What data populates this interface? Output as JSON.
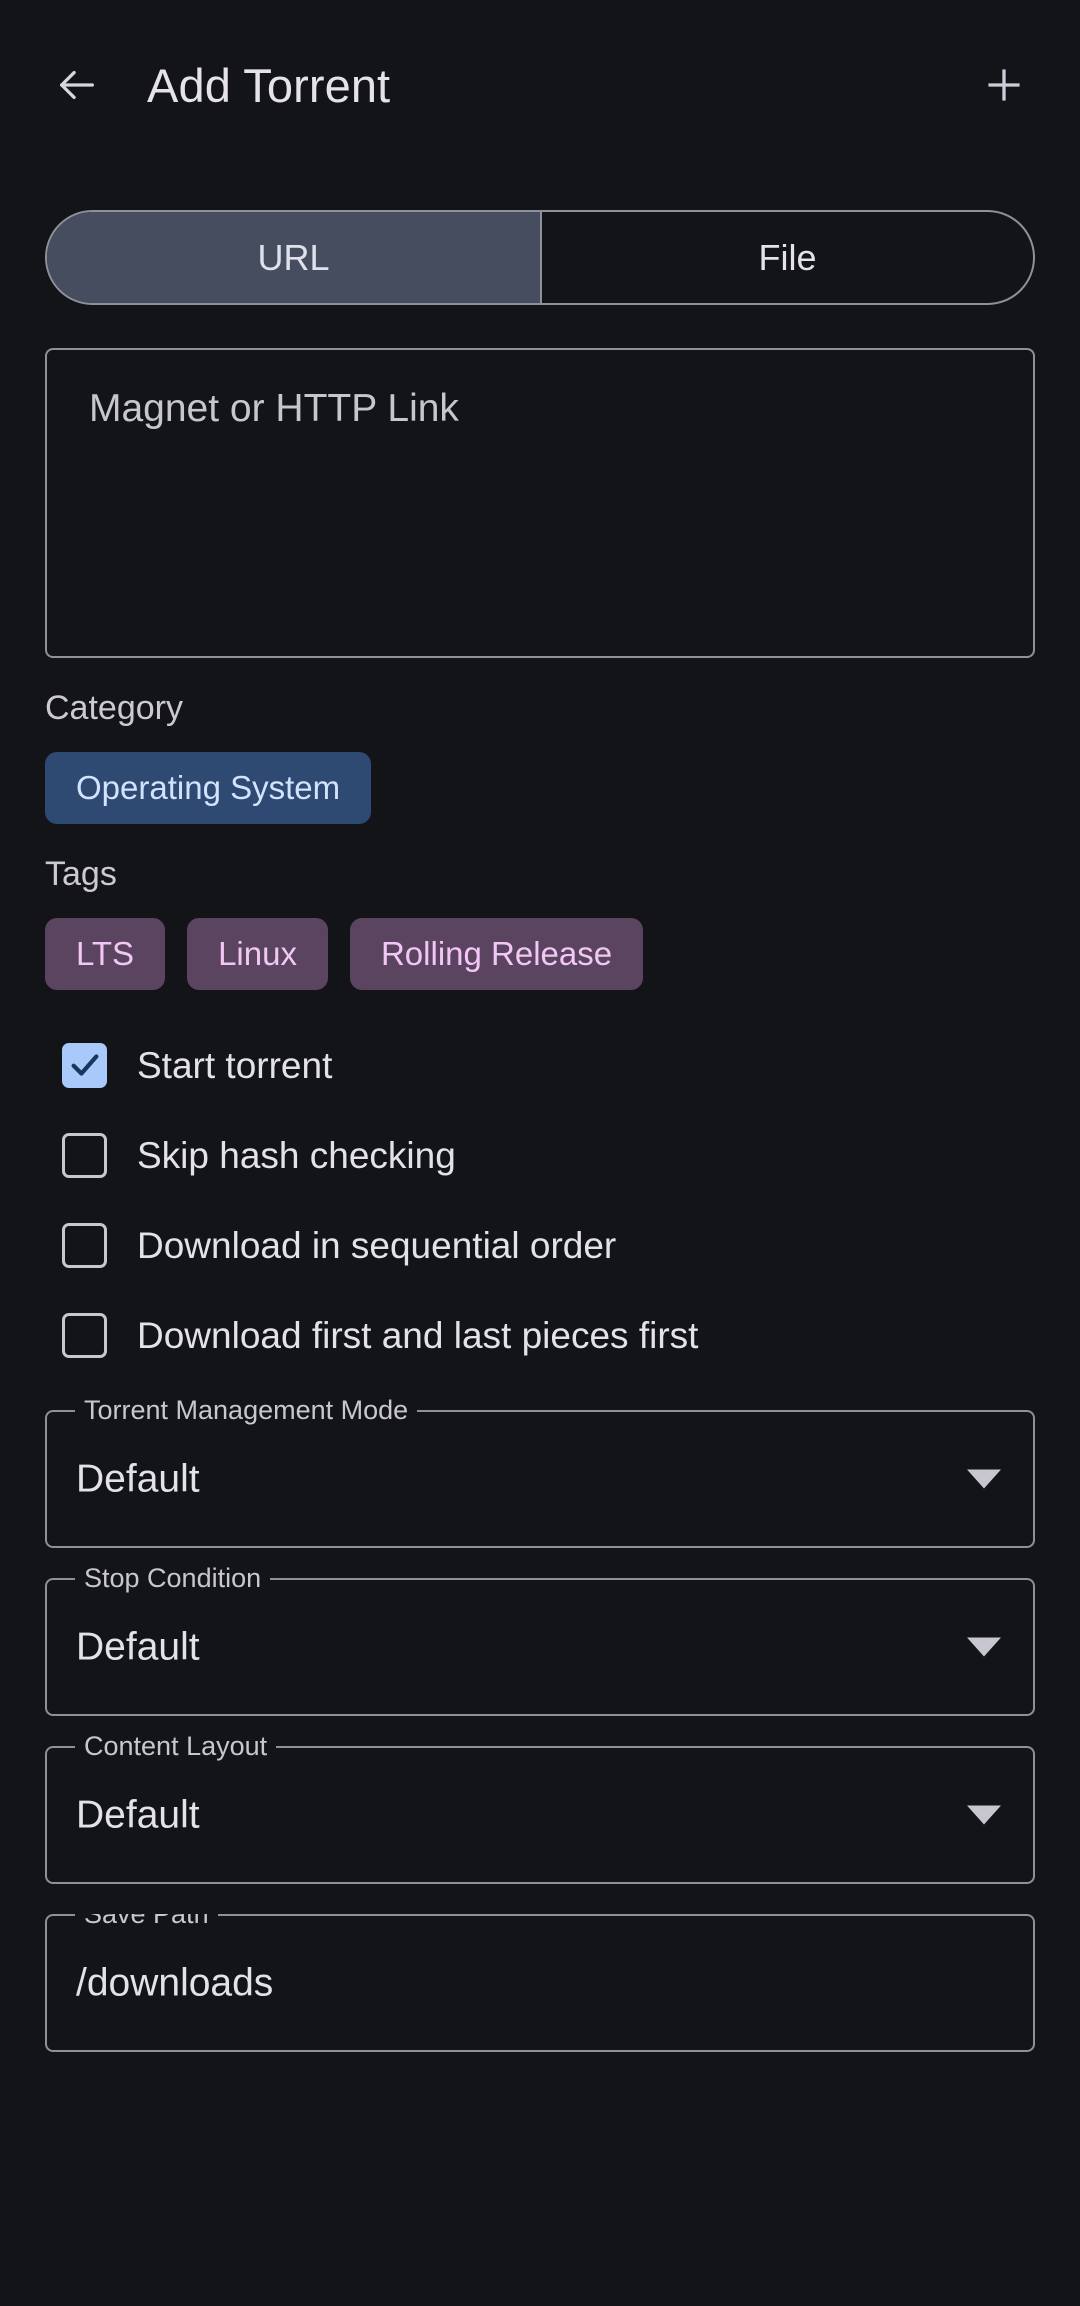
{
  "app": {
    "title": "Add Torrent",
    "back_icon": "arrow-left-icon",
    "add_icon": "plus-icon",
    "background_color": "#121418",
    "outline_color": "#8d9199"
  },
  "tabs": {
    "items": [
      {
        "label": "URL",
        "selected": true
      },
      {
        "label": "File",
        "selected": false
      }
    ],
    "selected_background": "#454d5f"
  },
  "url_input": {
    "placeholder": "Magnet or HTTP Link",
    "value": ""
  },
  "category": {
    "label": "Category",
    "chips": [
      {
        "label": "Operating System",
        "selected": true,
        "color": "#2e4a73",
        "text_color": "#d3e3fd"
      }
    ]
  },
  "tags": {
    "label": "Tags",
    "chips": [
      {
        "label": "LTS",
        "color": "#5a4460",
        "text_color": "#f3c7f5"
      },
      {
        "label": "Linux",
        "color": "#5a4460",
        "text_color": "#f3c7f5"
      },
      {
        "label": "Rolling Release",
        "color": "#5a4460",
        "text_color": "#f3c7f5"
      }
    ]
  },
  "checkboxes": [
    {
      "label": "Start torrent",
      "checked": true
    },
    {
      "label": "Skip hash checking",
      "checked": false
    },
    {
      "label": "Download in sequential order",
      "checked": false
    },
    {
      "label": "Download first and last pieces first",
      "checked": false
    }
  ],
  "checkbox_checked_color": "#a9c9fa",
  "dropdowns": [
    {
      "label": "Torrent Management Mode",
      "value": "Default",
      "arrow_icon": "chevron-down-icon"
    },
    {
      "label": "Stop Condition",
      "value": "Default",
      "arrow_icon": "chevron-down-icon"
    },
    {
      "label": "Content Layout",
      "value": "Default",
      "arrow_icon": "chevron-down-icon"
    }
  ],
  "save_path": {
    "label": "Save Path",
    "value": "/downloads"
  }
}
